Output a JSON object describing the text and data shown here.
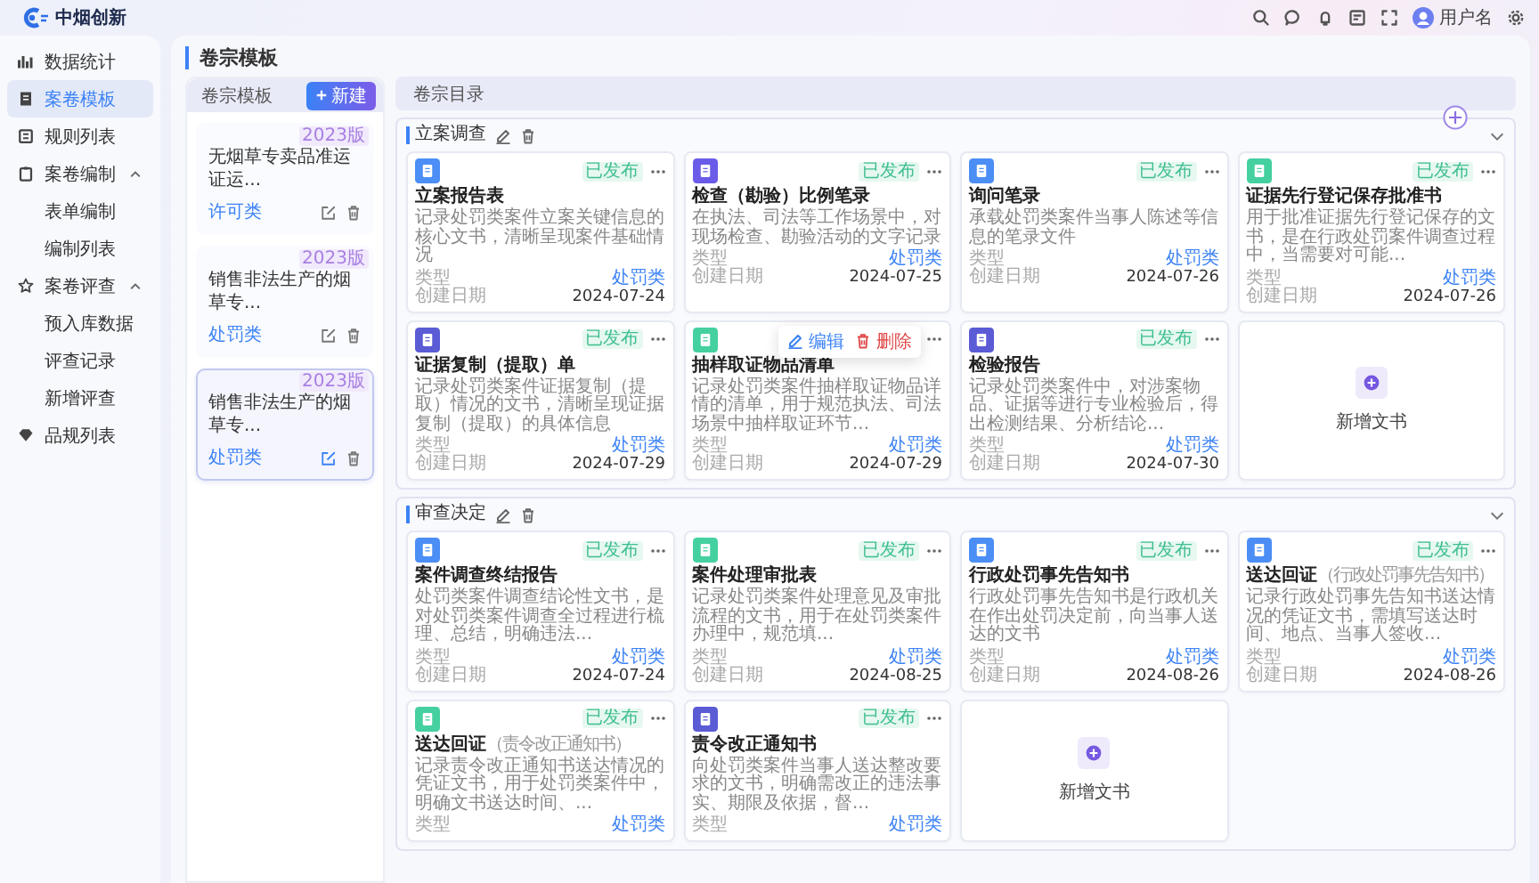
{
  "app": {
    "logo_text": "中烟创新",
    "user_name": "用户名"
  },
  "sidebar": {
    "items": [
      {
        "label": "数据统计",
        "selected": false
      },
      {
        "label": "案卷模板",
        "selected": true
      },
      {
        "label": "规则列表",
        "selected": false
      },
      {
        "label": "案卷编制",
        "selected": false,
        "expanded": true,
        "children": [
          {
            "label": "表单编制",
            "selected": false
          },
          {
            "label": "编制列表",
            "selected": false
          }
        ]
      },
      {
        "label": "案卷评查",
        "selected": false,
        "expanded": true,
        "children": [
          {
            "label": "预入库数据",
            "selected": false
          },
          {
            "label": "评查记录",
            "selected": false
          },
          {
            "label": "新增评查",
            "selected": false
          }
        ]
      },
      {
        "label": "品规列表",
        "selected": false
      }
    ]
  },
  "page": {
    "title": "卷宗模板"
  },
  "template_list": {
    "title": "卷宗模板",
    "new_button": "新建",
    "items": [
      {
        "title": "无烟草专卖品准运证运...",
        "version": "2023版",
        "category": "许可类",
        "selected": false
      },
      {
        "title": "销售非法生产的烟草专...",
        "version": "2023版",
        "category": "处罚类",
        "selected": false
      },
      {
        "title": "销售非法生产的烟草专...",
        "version": "2023版",
        "category": "处罚类",
        "selected": true
      }
    ]
  },
  "catalog": {
    "title": "卷宗目录",
    "sections": [
      {
        "title": "立案调查",
        "expanded": true,
        "cards": [
          {
            "kind": "doc",
            "color": "#4b8ef5",
            "title": "立案报告表",
            "status": "已发布",
            "description": "记录处罚类案件立案关键信息的核心文书，清晰呈现案件基础情况",
            "type_label": "类型",
            "type": "处罚类",
            "date_label": "创建日期",
            "date": "2024-07-24"
          },
          {
            "kind": "doc",
            "color": "#6a5ce8",
            "title": "检查（勘验）比例笔录",
            "status": "已发布",
            "description": "在执法、司法等工作场景中，对现场检查、勘验活动的文字记录",
            "type_label": "类型",
            "type": "处罚类",
            "date_label": "创建日期",
            "date": "2024-07-25"
          },
          {
            "kind": "doc",
            "color": "#4b8ef5",
            "title": "询问笔录",
            "status": "已发布",
            "description": "承载处罚类案件当事人陈述等信息的笔录文件",
            "type_label": "类型",
            "type": "处罚类",
            "date_label": "创建日期",
            "date": "2024-07-26"
          },
          {
            "kind": "doc",
            "color": "#45d0a0",
            "title": "证据先行登记保存批准书",
            "status": "已发布",
            "description": "用于批准证据先行登记保存的文书，是在行政处罚案件调查过程中，当需要对可能...",
            "type_label": "类型",
            "type": "处罚类",
            "date_label": "创建日期",
            "date": "2024-07-26"
          },
          {
            "kind": "doc",
            "color": "#5b5bd6",
            "title": "证据复制（提取）单",
            "status": "已发布",
            "description": "记录处罚类案件证据复制（提取）情况的文书，清晰呈现证据复制（提取）的具体信息",
            "type_label": "类型",
            "type": "处罚类",
            "date_label": "创建日期",
            "date": "2024-07-29"
          },
          {
            "kind": "doc",
            "color": "#45d0a0",
            "title": "抽样取证物品清单",
            "description": "记录处罚类案件抽样取证物品详情的清单，用于规范执法、司法场景中抽样取证环节...",
            "type_label": "类型",
            "type": "处罚类",
            "date_label": "创建日期",
            "date": "2024-07-29",
            "menu": [
              {
                "kind": "edit",
                "label": "编辑"
              },
              {
                "kind": "delete",
                "label": "删除"
              }
            ]
          },
          {
            "kind": "doc",
            "color": "#5b5bd6",
            "title": "检验报告",
            "status": "已发布",
            "description": "记录处罚类案件中，对涉案物品、证据等进行专业检验后，得出检测结果、分析结论...",
            "type_label": "类型",
            "type": "处罚类",
            "date_label": "创建日期",
            "date": "2024-07-30"
          },
          {
            "kind": "add",
            "label": "新增文书"
          }
        ]
      },
      {
        "title": "审查决定",
        "expanded": true,
        "cards": [
          {
            "kind": "doc",
            "color": "#4b8ef5",
            "title": "案件调查终结报告",
            "status": "已发布",
            "description": "处罚类案件调查结论性文书，是对处罚类案件调查全过程进行梳理、总结，明确违法...",
            "type_label": "类型",
            "type": "处罚类",
            "date_label": "创建日期",
            "date": "2024-07-24"
          },
          {
            "kind": "doc",
            "color": "#45d0a0",
            "title": "案件处理审批表",
            "status": "已发布",
            "description": "记录处罚类案件处理意见及审批流程的文书，用于在处罚类案件办理中，规范填...",
            "type_label": "类型",
            "type": "处罚类",
            "date_label": "创建日期",
            "date": "2024-08-25"
          },
          {
            "kind": "doc",
            "color": "#4b8ef5",
            "title": "行政处罚事先告知书",
            "status": "已发布",
            "description": "行政处罚事先告知书是行政机关在作出处罚决定前，向当事人送达的文书",
            "type_label": "类型",
            "type": "处罚类",
            "date_label": "创建日期",
            "date": "2024-08-26"
          },
          {
            "kind": "doc",
            "color": "#4b8ef5",
            "title": "送达回证",
            "subtitle": "（行政处罚事先告知书）",
            "status": "已发布",
            "description": "记录行政处罚事先告知书送达情况的凭证文书，需填写送达时间、地点、当事人签收...",
            "type_label": "类型",
            "type": "处罚类",
            "date_label": "创建日期",
            "date": "2024-08-26"
          },
          {
            "kind": "doc",
            "color": "#45d0a0",
            "title": "送达回证",
            "subtitle": "（责令改正通知书）",
            "status": "已发布",
            "description": "记录责令改正通知书送达情况的凭证文书，用于处罚类案件中，明确文书送达时间、...",
            "type_label": "类型",
            "type": "处罚类"
          },
          {
            "kind": "doc",
            "color": "#5b5bd6",
            "title": "责令改正通知书",
            "status": "已发布",
            "description": "向处罚类案件当事人送达整改要求的文书，明确需改正的违法事实、期限及依据，督...",
            "type_label": "类型",
            "type": "处罚类"
          },
          {
            "kind": "add",
            "label": "新增文书"
          }
        ]
      }
    ]
  }
}
